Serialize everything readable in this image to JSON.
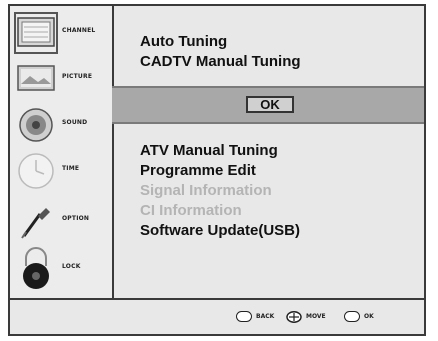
{
  "sidebar": {
    "items": [
      {
        "label": "CHANNEL",
        "icon": "channel-icon",
        "selected": true
      },
      {
        "label": "PICTURE",
        "icon": "picture-icon"
      },
      {
        "label": "SOUND",
        "icon": "sound-icon"
      },
      {
        "label": "TIME",
        "icon": "time-icon"
      },
      {
        "label": "OPTION",
        "icon": "option-icon"
      },
      {
        "label": "LOCK",
        "icon": "lock-icon"
      }
    ]
  },
  "menu": {
    "top_items": [
      "Auto Tuning",
      "CADTV Manual Tuning"
    ],
    "ok_label": "OK",
    "bottom_items": [
      {
        "label": "ATV Manual Tuning",
        "enabled": true
      },
      {
        "label": "Programme Edit",
        "enabled": true
      },
      {
        "label": "Signal Information",
        "enabled": false
      },
      {
        "label": "CI Information",
        "enabled": false
      },
      {
        "label": "Software Update(USB)",
        "enabled": true
      }
    ]
  },
  "footer": {
    "hints": [
      {
        "key": "MENU",
        "action": "BACK"
      },
      {
        "key": "arrows",
        "action": "MOVE"
      },
      {
        "key": "OK",
        "action": "OK"
      }
    ]
  }
}
